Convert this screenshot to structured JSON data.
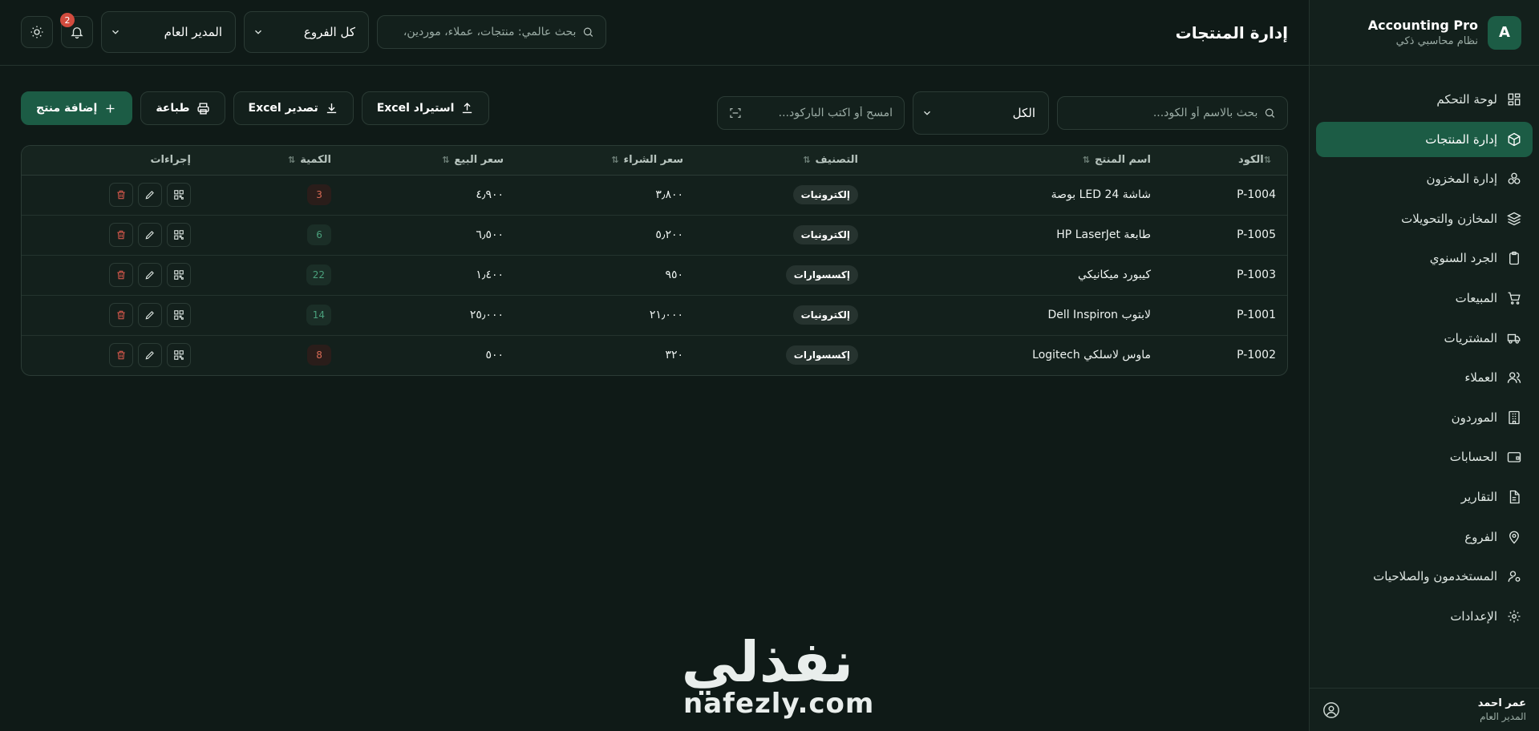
{
  "app": {
    "logo_letter": "A",
    "name": "Accounting Pro",
    "subtitle": "نظام محاسبي ذكي"
  },
  "sidebar": {
    "items": [
      {
        "label": "لوحة التحكم",
        "icon": "dashboard-icon",
        "active": false
      },
      {
        "label": "إدارة المنتجات",
        "icon": "box-icon",
        "active": true
      },
      {
        "label": "إدارة المخزون",
        "icon": "boxes-icon",
        "active": false
      },
      {
        "label": "المخازن والتحويلات",
        "icon": "layers-icon",
        "active": false
      },
      {
        "label": "الجرد السنوي",
        "icon": "clipboard-icon",
        "active": false
      },
      {
        "label": "المبيعات",
        "icon": "cart-icon",
        "active": false
      },
      {
        "label": "المشتريات",
        "icon": "truck-icon",
        "active": false
      },
      {
        "label": "العملاء",
        "icon": "users-icon",
        "active": false
      },
      {
        "label": "الموردون",
        "icon": "building-icon",
        "active": false
      },
      {
        "label": "الحسابات",
        "icon": "wallet-icon",
        "active": false
      },
      {
        "label": "التقارير",
        "icon": "file-icon",
        "active": false
      },
      {
        "label": "الفروع",
        "icon": "map-pin-icon",
        "active": false
      },
      {
        "label": "المستخدمون والصلاحيات",
        "icon": "user-cog-icon",
        "active": false
      },
      {
        "label": "الإعدادات",
        "icon": "gear-icon",
        "active": false
      }
    ]
  },
  "user": {
    "name": "عمر احمد",
    "role": "المدير العام"
  },
  "header": {
    "title": "إدارة المنتجات",
    "global_search_placeholder": "بحث عالمي: منتجات، عملاء، موردين،",
    "branch_select": "كل الفروع",
    "role_select": "المدير العام",
    "notification_count": "2"
  },
  "toolbar": {
    "search_placeholder": "بحث بالاسم أو الكود...",
    "category_select": "الكل",
    "barcode_placeholder": "امسح أو اكتب الباركود...",
    "import_label": "استيراد Excel",
    "export_label": "تصدير Excel",
    "print_label": "طباعة",
    "add_label": "إضافة منتج"
  },
  "table": {
    "headers": {
      "code": "الكود",
      "name": "اسم المنتج",
      "category": "التصنيف",
      "buy_price": "سعر الشراء",
      "sell_price": "سعر البيع",
      "quantity": "الكمية",
      "actions": "إجراءات"
    },
    "rows": [
      {
        "code": "P-1004",
        "name": "شاشة LED 24 بوصة",
        "category": "إلكترونيات",
        "buy_price": "٣٫٨٠٠",
        "sell_price": "٤٫٩٠٠",
        "quantity": "3",
        "qty_status": "low"
      },
      {
        "code": "P-1005",
        "name": "طابعة HP LaserJet",
        "category": "إلكترونيات",
        "buy_price": "٥٫٢٠٠",
        "sell_price": "٦٫٥٠٠",
        "quantity": "6",
        "qty_status": "ok"
      },
      {
        "code": "P-1003",
        "name": "كيبورد ميكانيكي",
        "category": "إكسسوارات",
        "buy_price": "٩٥٠",
        "sell_price": "١٫٤٠٠",
        "quantity": "22",
        "qty_status": "ok"
      },
      {
        "code": "P-1001",
        "name": "لابتوب Dell Inspiron",
        "category": "إلكترونيات",
        "buy_price": "٢١٫٠٠٠",
        "sell_price": "٢٥٫٠٠٠",
        "quantity": "14",
        "qty_status": "ok"
      },
      {
        "code": "P-1002",
        "name": "ماوس لاسلكي Logitech",
        "category": "إكسسوارات",
        "buy_price": "٣٢٠",
        "sell_price": "٥٠٠",
        "quantity": "8",
        "qty_status": "low"
      }
    ]
  },
  "watermark": {
    "arabic": "نفذلي",
    "latin": "nafezly.com"
  },
  "colors": {
    "background": "#0f1a17",
    "panel": "#13201c",
    "accent": "#1c5c45",
    "danger": "#d24b3e",
    "qty_low": "#d86a55",
    "qty_ok": "#4aa07c"
  }
}
